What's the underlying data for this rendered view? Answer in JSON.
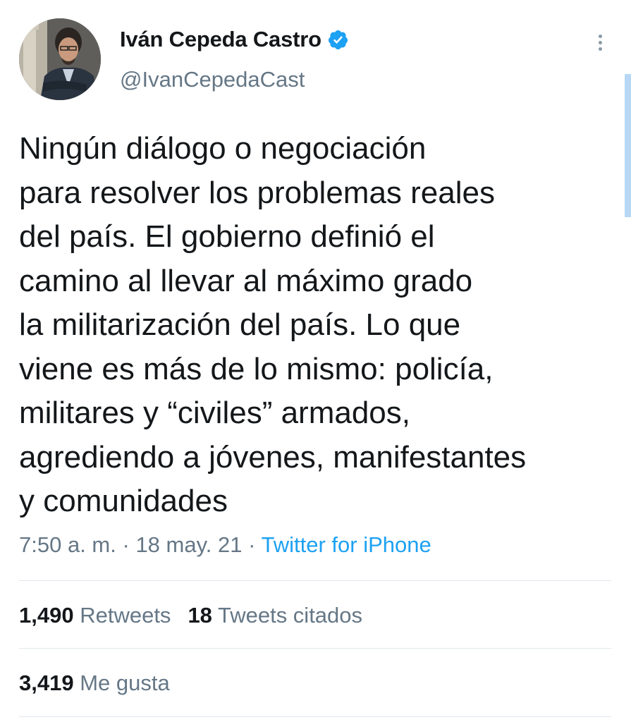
{
  "tweet": {
    "author": {
      "display_name": "Iván Cepeda Castro",
      "handle": "@IvanCepedaCast",
      "verified": true,
      "avatar_icon": "profile-photo"
    },
    "text": "Ningún diálogo o negociación\npara resolver los problemas reales\ndel país. El gobierno definió el\ncamino al llevar al máximo grado\nla militarización del país. Lo que\nviene es más de lo mismo: policía,\nmilitares y “civiles” armados,\nagrediendo a jóvenes, manifestantes\ny comunidades",
    "time": "7:50 a. m.",
    "separator": "·",
    "date": "18 may. 21",
    "source": "Twitter for iPhone",
    "stats": {
      "retweets": {
        "count": "1,490",
        "label": "Retweets"
      },
      "quotes": {
        "count": "18",
        "label": "Tweets citados"
      },
      "likes": {
        "count": "3,419",
        "label": "Me gusta"
      }
    }
  },
  "colors": {
    "text": "#14171a",
    "secondary": "#657786",
    "accent": "#1da1f2",
    "divider": "#e1e8ed"
  },
  "icons": {
    "verified": "verified-badge-icon",
    "more": "more-vertical-icon"
  }
}
